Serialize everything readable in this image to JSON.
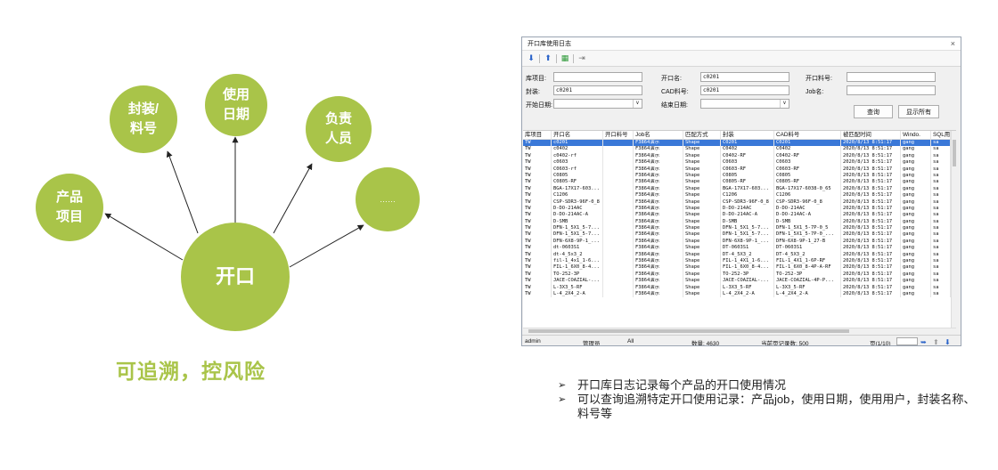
{
  "diagram": {
    "center": "开口",
    "nodes": [
      "产品\n项目",
      "封装/\n料号",
      "使用\n日期",
      "负责\n人员",
      "……"
    ],
    "tagline": "可追溯，控风险",
    "accent_color": "#a9c449"
  },
  "window": {
    "title": "开口库使用日志",
    "close_icon": "×",
    "toolbar": [
      "down-arrow-icon",
      "up-arrow-icon",
      "grid-icon",
      "exit-icon"
    ],
    "form": {
      "project_label": "库项目:",
      "project_value": "",
      "open_name_label": "开口名:",
      "open_name_value": "c0201",
      "open_part_label": "开口料号:",
      "open_part_value": "",
      "package_label": "封装:",
      "package_value": "c0201",
      "cad_part_label": "CAD料号:",
      "cad_part_value": "c0201",
      "job_label": "Job名:",
      "job_value": "",
      "start_date_label": "开始日期:",
      "end_date_label": "结束日期:",
      "query_button": "查询",
      "show_all_button": "显示所有"
    },
    "columns": [
      "库项目",
      "开口名",
      "开口料号",
      "Job名",
      "匹配方式",
      "封装",
      "CAD料号",
      "被匹配时间",
      "Windo.",
      "SQL用"
    ],
    "rows": [
      [
        "TW",
        "c0201",
        "",
        "F3864演示",
        "Shape",
        "C0201",
        "C0201",
        "2020/8/13 8:51:17",
        "gang",
        "sa"
      ],
      [
        "TW",
        "c0402",
        "",
        "F3864演示",
        "Shape",
        "C0402",
        "C0402",
        "2020/8/13 8:51:17",
        "gang",
        "sa"
      ],
      [
        "TW",
        "c0402-rf",
        "",
        "F3864演示",
        "Shape",
        "C0402-RF",
        "C0402-RF",
        "2020/8/13 8:51:17",
        "gang",
        "sa"
      ],
      [
        "TW",
        "c0603",
        "",
        "F3864演示",
        "Shape",
        "C0603",
        "C0603",
        "2020/8/13 8:51:17",
        "gang",
        "sa"
      ],
      [
        "TW",
        "C0603-rf",
        "",
        "F3864演示",
        "Shape",
        "C0603-RF",
        "C0603-RF",
        "2020/8/13 8:51:17",
        "gang",
        "sa"
      ],
      [
        "TW",
        "C0805",
        "",
        "F3864演示",
        "Shape",
        "C0805",
        "C0805",
        "2020/8/13 8:51:17",
        "gang",
        "sa"
      ],
      [
        "TW",
        "C0805-RF",
        "",
        "F3864演示",
        "Shape",
        "C0805-RF",
        "C0805-RF",
        "2020/8/13 8:51:17",
        "gang",
        "sa"
      ],
      [
        "TW",
        "BGA-17X17-603...",
        "",
        "F3864演示",
        "Shape",
        "BGA-17X17-603...",
        "BGA-17X17-6038-0_65",
        "2020/8/13 8:51:17",
        "gang",
        "sa"
      ],
      [
        "TW",
        "C1206",
        "",
        "F3864演示",
        "Shape",
        "C1206",
        "C1206",
        "2020/8/13 8:51:17",
        "gang",
        "sa"
      ],
      [
        "TW",
        "CSP-SDR3-96F-0_8",
        "",
        "F3864演示",
        "Shape",
        "CSP-SDR3-96F-0_8",
        "CSP-SDR3-96F-0_8",
        "2020/8/13 8:51:17",
        "gang",
        "sa"
      ],
      [
        "TW",
        "D-DO-214AC",
        "",
        "F3864演示",
        "Shape",
        "D-DO-214AC",
        "D-DO-214AC",
        "2020/8/13 8:51:17",
        "gang",
        "sa"
      ],
      [
        "TW",
        "D-DO-214AC-A",
        "",
        "F3864演示",
        "Shape",
        "D-DO-214AC-A",
        "D-DO-214AC-A",
        "2020/8/13 8:51:17",
        "gang",
        "sa"
      ],
      [
        "TW",
        "D-SMB",
        "",
        "F3864演示",
        "Shape",
        "D-SMB",
        "D-SMB",
        "2020/8/13 8:51:17",
        "gang",
        "sa"
      ],
      [
        "TW",
        "DFN-1_5X1_5-7...",
        "",
        "F3864演示",
        "Shape",
        "DFN-1_5X1_5-7...",
        "DFN-1_5X1_5-7P-0_5",
        "2020/8/13 8:51:17",
        "gang",
        "sa"
      ],
      [
        "TW",
        "DFN-1_5X1_5-7...",
        "",
        "F3864演示",
        "Shape",
        "DFN-1_5X1_5-7...",
        "DFN-1_5X1_5-7P-0_...",
        "2020/8/13 8:51:17",
        "gang",
        "sa"
      ],
      [
        "TW",
        "DFN-6X8-9P-1_...",
        "",
        "F3864演示",
        "Shape",
        "DFN-6X8-9P-1_...",
        "DFN-6X8-9P-1_27-B",
        "2020/8/13 8:51:17",
        "gang",
        "sa"
      ],
      [
        "TW",
        "dt-0603S1",
        "",
        "F3864演示",
        "Shape",
        "DT-0603S1",
        "DT-0603S1",
        "2020/8/13 8:51:17",
        "gang",
        "sa"
      ],
      [
        "TW",
        "dt-4_5x3_2",
        "",
        "F3864演示",
        "Shape",
        "DT-4_5X3_2",
        "DT-4_5X3_2",
        "2020/8/13 8:51:17",
        "gang",
        "sa"
      ],
      [
        "TW",
        "fil-1_4x1_1-6...",
        "",
        "F3864演示",
        "Shape",
        "FIL-1_4X1_1-6...",
        "FIL-1_4X1_1-6P-RF",
        "2020/8/13 8:51:17",
        "gang",
        "sa"
      ],
      [
        "TW",
        "FIL-1_6X0_8-4...",
        "",
        "F3864演示",
        "Shape",
        "FIL-1_6X0_8-4...",
        "FIL-1_6X0_8-4P-A-RF",
        "2020/8/13 8:51:17",
        "gang",
        "sa"
      ],
      [
        "TW",
        "TO-252-3P",
        "",
        "F3864演示",
        "Shape",
        "TO-252-3P",
        "TO-252-3P",
        "2020/8/13 8:51:17",
        "gang",
        "sa"
      ],
      [
        "TW",
        "JACE-COAZIAL-...",
        "",
        "F3864演示",
        "Shape",
        "JACE-COAZIAL-...",
        "JACE-COAZIAL-4P-P...",
        "2020/8/13 8:51:17",
        "gang",
        "sa"
      ],
      [
        "TW",
        "L-3X3_5-RF",
        "",
        "F3864演示",
        "Shape",
        "L-3X3_5-RF",
        "L-3X3_5-RF",
        "2020/8/13 8:51:17",
        "gang",
        "sa"
      ],
      [
        "TW",
        "L-4_2X4_2-A",
        "",
        "F3864演示",
        "Shape",
        "L-4_2X4_2-A",
        "L-4_2X4_2-A",
        "2020/8/13 8:51:17",
        "gang",
        "sa"
      ]
    ],
    "status": {
      "user": "admin",
      "role": "管理员",
      "filter": "All",
      "count_label": "数量: 4630",
      "page_count": "当前页记录数: 500",
      "page": "页(1/10)"
    }
  },
  "bullets": [
    "开口库日志记录每个产品的开口使用情况",
    "可以查询追溯特定开口使用记录：产品job，使用日期，使用用户，封装名称、料号等"
  ]
}
